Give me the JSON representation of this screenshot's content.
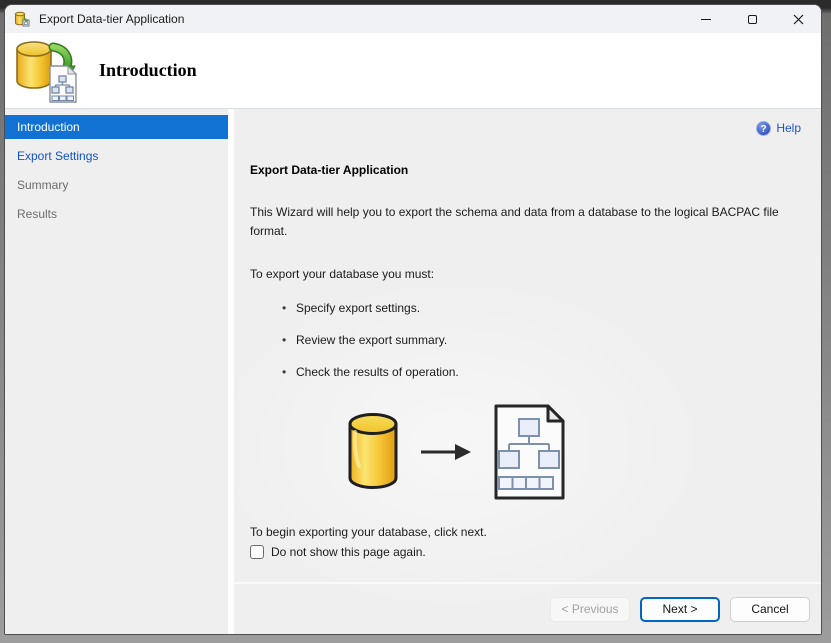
{
  "titlebar": {
    "title": "Export Data-tier Application"
  },
  "header": {
    "title": "Introduction"
  },
  "sidebar": {
    "items": [
      {
        "label": "Introduction",
        "state": "selected"
      },
      {
        "label": "Export Settings",
        "state": "link"
      },
      {
        "label": "Summary",
        "state": "upcoming"
      },
      {
        "label": "Results",
        "state": "upcoming"
      }
    ]
  },
  "content": {
    "help_label": "Help",
    "heading": "Export Data-tier Application",
    "intro": "This Wizard will help you to export the schema and data from a database to the logical BACPAC file format.",
    "list_intro": "To export your database you must:",
    "bullets": [
      {
        "text": "Specify export settings."
      },
      {
        "text": "Review the export summary."
      },
      {
        "text": "Check the results of operation."
      }
    ],
    "closing": "To begin exporting your database, click next.",
    "checkbox": {
      "label": "Do not show this page again.",
      "checked": false
    }
  },
  "footer": {
    "previous_label": "< Previous",
    "next_label": "Next >",
    "cancel_label": "Cancel"
  },
  "icons": {
    "titlebar_app": "database-export-icon",
    "window_controls": [
      "minimize-icon",
      "maximize-icon",
      "close-icon"
    ],
    "help": "help-question-icon",
    "header": "database-export-large-icon",
    "illustration": [
      "database-cylinder-icon",
      "arrow-right-icon",
      "bacpac-document-icon"
    ]
  },
  "colors": {
    "accent_blue": "#1272d4",
    "link_blue": "#1353c8",
    "upcoming_text": "#6d6d6d",
    "next_button_border": "#0067c0",
    "database_gold": "#f2c131",
    "arrow_green": "#58ab3a"
  }
}
